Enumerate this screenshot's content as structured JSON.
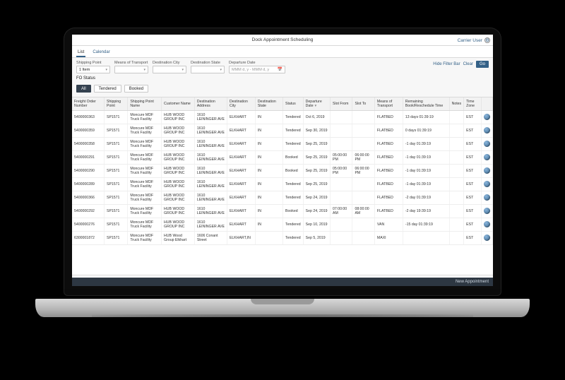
{
  "header": {
    "title": "Dock Appointment Scheduling",
    "user_label": "Carrier User",
    "gear_name": "gear-icon"
  },
  "tabs": {
    "list": "List",
    "calendar": "Calendar"
  },
  "filters": {
    "shipping_point_label": "Shipping Point",
    "shipping_point_value": "1 Item",
    "means_label": "Means of Transport",
    "means_value": "",
    "dest_city_label": "Destination City",
    "dest_city_value": "",
    "dest_state_label": "Destination State",
    "dest_state_value": "",
    "dep_date_label": "Departure Date",
    "dep_date_placeholder": "MMM d, y - MMM d, y",
    "hide_filter": "Hide Filter Bar",
    "clear": "Clear",
    "go": "Go",
    "fo_status_label": "FO Status",
    "fo_all": "All",
    "fo_tendered": "Tendered",
    "fo_booked": "Booked"
  },
  "table": {
    "columns": [
      "Freight Order Number",
      "Shipping Point",
      "Shipping Point Name",
      "Customer Name",
      "Destination Address",
      "Destination City",
      "Destination State",
      "Status",
      "Departure Date",
      "Slot From",
      "Slot To",
      "Means of Transport",
      "Remaining Book/Reschedule Time",
      "Notes",
      "Time Zone",
      ""
    ],
    "rows": [
      {
        "fo": "5400000363",
        "sp": "SP1571",
        "spn": "Moncure MDF Truck Facility",
        "cust": "HUB WOOD GROUP INC",
        "addr": "1610 LEININGER AVE",
        "city": "ELKHART",
        "st": "IN",
        "status": "Tendered",
        "dep": "Oct 6, 2019",
        "from": "",
        "to": "",
        "mot": "FLATBED",
        "rem": "13 days 01:39:19",
        "notes": "",
        "tz": "EST"
      },
      {
        "fo": "5400000359",
        "sp": "SP1571",
        "spn": "Moncure MDF Truck Facility",
        "cust": "HUB WOOD GROUP INC",
        "addr": "1610 LEININGER AVE",
        "city": "ELKHART",
        "st": "IN",
        "status": "Tendered",
        "dep": "Sep 30, 2019",
        "from": "",
        "to": "",
        "mot": "FLATBED",
        "rem": "0 days 01:39:19",
        "notes": "",
        "tz": "EST"
      },
      {
        "fo": "5400000358",
        "sp": "SP1571",
        "spn": "Moncure MDF Truck Facility",
        "cust": "HUB WOOD GROUP INC",
        "addr": "1610 LEININGER AVE",
        "city": "ELKHART",
        "st": "IN",
        "status": "Tendered",
        "dep": "Sep 25, 2019",
        "from": "",
        "to": "",
        "mot": "FLATBED",
        "rem": "-1 day 01:39:19",
        "notes": "",
        "tz": "EST"
      },
      {
        "fo": "5400000291",
        "sp": "SP1571",
        "spn": "Moncure MDF Truck Facility",
        "cust": "HUB WOOD GROUP INC",
        "addr": "1610 LEININGER AVE",
        "city": "ELKHART",
        "st": "IN",
        "status": "Booked",
        "dep": "Sep 25, 2019",
        "from": "05:00:00 PM",
        "to": "06:00:00 PM",
        "mot": "FLATBED",
        "rem": "-1 day 01:39:19",
        "notes": "",
        "tz": "EST"
      },
      {
        "fo": "5400000290",
        "sp": "SP1571",
        "spn": "Moncure MDF Truck Facility",
        "cust": "HUB WOOD GROUP INC",
        "addr": "1610 LEININGER AVE",
        "city": "ELKHART",
        "st": "IN",
        "status": "Booked",
        "dep": "Sep 25, 2019",
        "from": "05:00:00 PM",
        "to": "06:00:00 PM",
        "mot": "FLATBED",
        "rem": "-1 day 01:39:19",
        "notes": "",
        "tz": "EST"
      },
      {
        "fo": "5400000289",
        "sp": "SP1571",
        "spn": "Moncure MDF Truck Facility",
        "cust": "HUB WOOD GROUP INC",
        "addr": "1610 LEININGER AVE",
        "city": "ELKHART",
        "st": "IN",
        "status": "Tendered",
        "dep": "Sep 25, 2019",
        "from": "",
        "to": "",
        "mot": "FLATBED",
        "rem": "-1 day 01:39:19",
        "notes": "",
        "tz": "EST"
      },
      {
        "fo": "5400000366",
        "sp": "SP1571",
        "spn": "Moncure MDF Truck Facility",
        "cust": "HUB WOOD GROUP INC",
        "addr": "1610 LEININGER AVE",
        "city": "ELKHART",
        "st": "IN",
        "status": "Tendered",
        "dep": "Sep 24, 2019",
        "from": "",
        "to": "",
        "mot": "FLATBED",
        "rem": "-2 day 01:39:19",
        "notes": "",
        "tz": "EST"
      },
      {
        "fo": "5400000292",
        "sp": "SP1571",
        "spn": "Moncure MDF Truck Facility",
        "cust": "HUB WOOD GROUP INC",
        "addr": "1610 LEININGER AVE",
        "city": "ELKHART",
        "st": "IN",
        "status": "Booked",
        "dep": "Sep 24, 2019",
        "from": "07:00:00 AM",
        "to": "08:00:00 AM",
        "mot": "FLATBED",
        "rem": "-2 day 19:39:19",
        "notes": "",
        "tz": "EST"
      },
      {
        "fo": "5400000276",
        "sp": "SP1571",
        "spn": "Moncure MDF Truck Facility",
        "cust": "HUB WOOD GROUP INC",
        "addr": "1610 LEININGER AVE",
        "city": "ELKHART",
        "st": "IN",
        "status": "Tendered",
        "dep": "Sep 10, 2019",
        "from": "",
        "to": "",
        "mot": "VAN",
        "rem": "-15 day 01:39:19",
        "notes": "",
        "tz": "EST"
      },
      {
        "fo": "6300001872",
        "sp": "SP1571",
        "spn": "Moncure MDF Truck Facility",
        "cust": "HUB Wood Group Elkhart",
        "addr": "1606 Conant Street",
        "city": "ELKHART,IN",
        "st": "",
        "status": "Tendered",
        "dep": "Sep 5, 2019",
        "from": "",
        "to": "",
        "mot": "MAXI",
        "rem": "",
        "notes": "",
        "tz": "EST"
      }
    ]
  },
  "footer": {
    "new_appointment": "New Appointment"
  }
}
